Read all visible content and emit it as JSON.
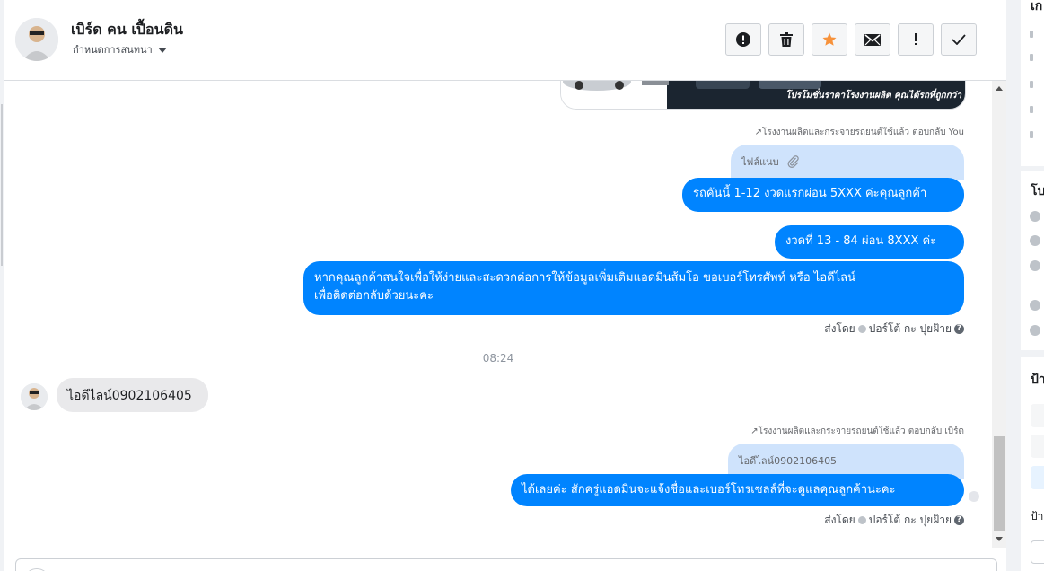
{
  "header": {
    "contact_name": "เบิร์ด คน เปื้อนดิน",
    "assign_label": "กำหนดการสนทนา",
    "actions": [
      {
        "name": "report-spam-button",
        "icon": "alert-circle-icon"
      },
      {
        "name": "delete-button",
        "icon": "trash-icon"
      },
      {
        "name": "star-button",
        "icon": "star-icon",
        "color": "#f7923b"
      },
      {
        "name": "mark-unread-button",
        "icon": "envelope-icon"
      },
      {
        "name": "follow-up-button",
        "icon": "exclamation-icon"
      },
      {
        "name": "mark-done-button",
        "icon": "checkmark-icon"
      }
    ]
  },
  "messages": {
    "image_caption": "โปรโมชั่นราคาโรงงานผลิต คุณได้รถที่ถูกกว่า",
    "reply1_meta": "โรงงานผลิตและกระจายรถยนต์ใช้แล้ว ตอบกลับ You",
    "reply1_quoted": "ไฟล์แนบ",
    "msg1": "รถคันนี้ 1-12 งวดแรกผ่อน 5XXX ค่ะคุณลูกค้า",
    "msg2": "งวดที่ 13 - 84 ผ่อน 8XXX ค่ะ",
    "msg3_line1": "หากคุณลูกค้าสนใจเพื่อให้ง่ายและสะดวกต่อการให้ข้อมูลเพิ่มเติมแอดมินส้มโอ ขอเบอร์โทรศัพท์ หรือ ไอดีไลน์",
    "msg3_line2": "เพื่อติดต่อกลับด้วยนะคะ",
    "sent_by_label": "ส่งโดย",
    "sent_by_name": "ปอร์โต้ กะ ปุยฝ้าย",
    "help_glyph": "?",
    "time_divider": "08:24",
    "incoming1": "ไอดีไลน์0902106405",
    "reply2_meta": "โรงงานผลิตและกระจายรถยนต์ใช้แล้ว ตอบกลับ เบิร์ด",
    "reply2_quoted": "ไอดีไลน์0902106405",
    "msg4": "ได้เลยค่ะ สักครู่แอดมินจะแจ้งชื่อและเบอร์โทรเซลล์ที่จะดูแลคุณลูกค้านะคะ"
  },
  "right_panel": {
    "section1_title": "เก",
    "section2_title": "โบ",
    "section3_title": "ป้า",
    "section3_sub": "ป้า"
  },
  "colors": {
    "outgoing_bubble": "#0084ff",
    "quoted_bubble": "#cfe3fc",
    "incoming_bubble": "#e9e9eb",
    "star": "#f7923b"
  }
}
